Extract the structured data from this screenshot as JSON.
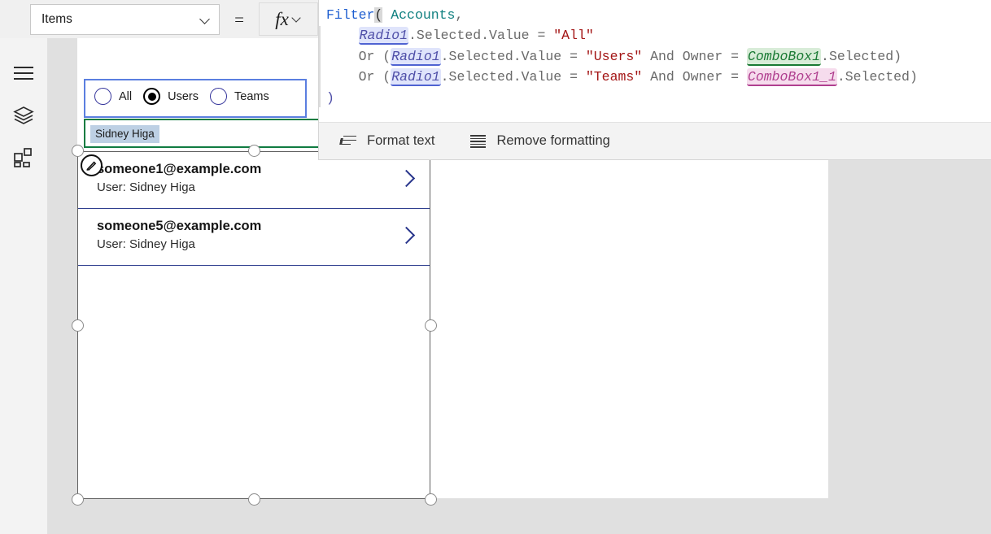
{
  "topbar": {
    "property_select": {
      "value": "Items",
      "icon": "chevron-down-icon"
    },
    "equals": "=",
    "fx_button": {
      "glyph": "fx",
      "icon": "chevron-down-icon"
    }
  },
  "sidebar": {
    "items": [
      {
        "name": "menu",
        "icon": "hamburger-menu-icon"
      },
      {
        "name": "tree-view",
        "icon": "layers-icon"
      },
      {
        "name": "insert",
        "icon": "components-grid-icon"
      }
    ]
  },
  "formula": {
    "lines": [
      {
        "parts": [
          {
            "t": "Filter",
            "k": "fn"
          },
          {
            "t": "(",
            "k": "paren-hl"
          },
          {
            "t": " ",
            "k": "op"
          },
          {
            "t": "Accounts",
            "k": "tbl"
          },
          {
            "t": ",",
            "k": "op"
          }
        ]
      },
      {
        "parts": [
          {
            "t": "    ",
            "k": "op"
          },
          {
            "t": "Radio1",
            "k": "pill-blue"
          },
          {
            "t": ".Selected.Value = ",
            "k": "op"
          },
          {
            "t": "\"All\"",
            "k": "str"
          }
        ]
      },
      {
        "parts": [
          {
            "t": "    Or (",
            "k": "op"
          },
          {
            "t": "Radio1",
            "k": "pill-blue"
          },
          {
            "t": ".Selected.Value = ",
            "k": "op"
          },
          {
            "t": "\"Users\"",
            "k": "str"
          },
          {
            "t": " And Owner = ",
            "k": "op"
          },
          {
            "t": "ComboBox1",
            "k": "pill-green"
          },
          {
            "t": ".Selected)",
            "k": "op"
          }
        ]
      },
      {
        "parts": [
          {
            "t": "    Or (",
            "k": "op"
          },
          {
            "t": "Radio1",
            "k": "pill-blue"
          },
          {
            "t": ".Selected.Value = ",
            "k": "op"
          },
          {
            "t": "\"Teams\"",
            "k": "str"
          },
          {
            "t": " And Owner = ",
            "k": "op"
          },
          {
            "t": "ComboBox1_1",
            "k": "pill-pink"
          },
          {
            "t": ".Selected)",
            "k": "op"
          }
        ]
      },
      {
        "parts": [
          {
            "t": ")",
            "k": "paren-close"
          }
        ]
      }
    ],
    "toolbar": {
      "format_text": {
        "label": "Format text",
        "icon": "format-text-icon"
      },
      "remove_formatting": {
        "label": "Remove formatting",
        "icon": "remove-formatting-icon"
      }
    }
  },
  "canvas": {
    "radio_control": {
      "name": "Radio1",
      "options": [
        {
          "label": "All",
          "selected": false
        },
        {
          "label": "Users",
          "selected": true
        },
        {
          "label": "Teams",
          "selected": false
        }
      ]
    },
    "combobox_control": {
      "name": "ComboBox1",
      "selected_chip": "Sidney Higa"
    },
    "gallery": {
      "edit_badge_icon": "pencil-edit-icon",
      "rows": [
        {
          "title": "someone1@example.com",
          "subtitle": "User: Sidney Higa",
          "chevron": "chevron-right-icon"
        },
        {
          "title": "someone5@example.com",
          "subtitle": "User: Sidney Higa",
          "chevron": "chevron-right-icon"
        }
      ]
    }
  },
  "colors": {
    "radio_border": "#5b7fe0",
    "combo_border": "#107c41",
    "chevron": "#27348b",
    "chip_bg": "#bdd0e4"
  }
}
